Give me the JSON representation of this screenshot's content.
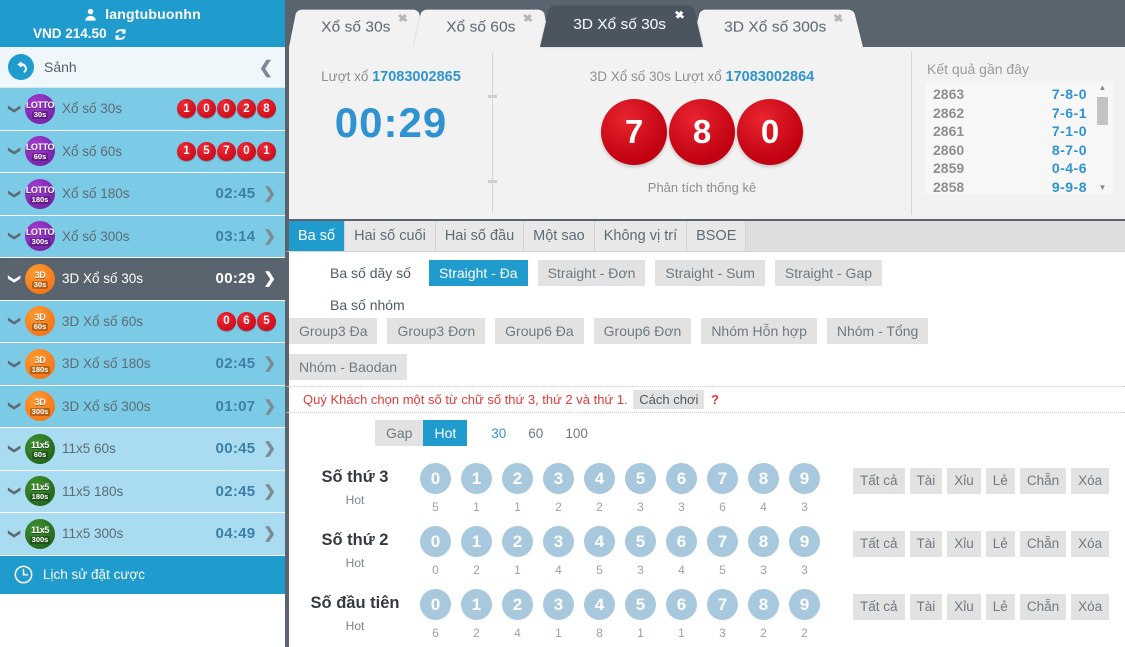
{
  "account": {
    "username": "langtubuonhn",
    "currency_label": "VND",
    "balance": "214.50",
    "user_icon": "user-icon",
    "refresh_icon": "refresh-icon"
  },
  "lobby": {
    "label": "Sảnh",
    "back_icon": "back-arrow-icon",
    "collapse_icon": "chevron-left-icon"
  },
  "sidebar": {
    "games": [
      {
        "name": "Xổ số 30s",
        "badge": "lotto",
        "badge_top": "LOTTO",
        "badge_bot": "30s",
        "type": "balls",
        "balls": [
          "1",
          "0",
          "0",
          "2",
          "8"
        ],
        "timer": "",
        "style": "alt"
      },
      {
        "name": "Xổ số 60s",
        "badge": "lotto",
        "badge_top": "LOTTO",
        "badge_bot": "60s",
        "type": "balls",
        "balls": [
          "1",
          "5",
          "7",
          "0",
          "1"
        ],
        "timer": "",
        "style": "alt"
      },
      {
        "name": "Xổ số 180s",
        "badge": "lotto",
        "badge_top": "LOTTO",
        "badge_bot": "180s",
        "type": "timer",
        "balls": [],
        "timer": "02:45",
        "style": "alt"
      },
      {
        "name": "Xổ số 300s",
        "badge": "lotto",
        "badge_top": "LOTTO",
        "badge_bot": "300s",
        "type": "timer",
        "balls": [],
        "timer": "03:14",
        "style": "alt"
      },
      {
        "name": "3D Xổ số 30s",
        "badge": "threed",
        "badge_top": "3D",
        "badge_bot": "30s",
        "type": "timer",
        "balls": [],
        "timer": "00:29",
        "style": "active"
      },
      {
        "name": "3D Xổ số 60s",
        "badge": "threed",
        "badge_top": "3D",
        "badge_bot": "60s",
        "type": "balls",
        "balls": [
          "0",
          "6",
          "5"
        ],
        "timer": "",
        "style": "alt"
      },
      {
        "name": "3D Xổ số 180s",
        "badge": "threed",
        "badge_top": "3D",
        "badge_bot": "180s",
        "type": "timer",
        "balls": [],
        "timer": "02:45",
        "style": "alt"
      },
      {
        "name": "3D Xổ số 300s",
        "badge": "threed",
        "badge_top": "3D",
        "badge_bot": "300s",
        "type": "timer",
        "balls": [],
        "timer": "01:07",
        "style": "alt"
      },
      {
        "name": "11x5 60s",
        "badge": "elevenx",
        "badge_top": "11x5",
        "badge_bot": "60s",
        "type": "timer",
        "balls": [],
        "timer": "00:45",
        "style": "plain"
      },
      {
        "name": "11x5 180s",
        "badge": "elevenx",
        "badge_top": "11x5",
        "badge_bot": "180s",
        "type": "timer",
        "balls": [],
        "timer": "02:45",
        "style": "plain"
      },
      {
        "name": "11x5 300s",
        "badge": "elevenx",
        "badge_top": "11x5",
        "badge_bot": "300s",
        "type": "timer",
        "balls": [],
        "timer": "04:49",
        "style": "plain"
      }
    ],
    "history": {
      "label": "Lịch sử đặt cược",
      "icon": "clock-icon"
    }
  },
  "tabs": [
    {
      "label": "Xổ số 30s",
      "active": false
    },
    {
      "label": "Xổ số 60s",
      "active": false
    },
    {
      "label": "3D Xổ số 30s",
      "active": true
    },
    {
      "label": "3D Xổ số 300s",
      "active": false
    }
  ],
  "board": {
    "left_prefix": "Lượt xổ",
    "left_draw_id": "17083002865",
    "countdown": "00:29",
    "mid_prefix": "3D Xổ số 30s Lượt xổ",
    "mid_draw_id": "17083002864",
    "draw_numbers": [
      "7",
      "8",
      "0"
    ],
    "analysis_label": "Phân tích thống kê",
    "recent_title": "Kết quả gần đây",
    "recent": [
      {
        "id": "2863",
        "value": "7-8-0"
      },
      {
        "id": "2862",
        "value": "7-6-1"
      },
      {
        "id": "2861",
        "value": "7-1-0"
      },
      {
        "id": "2860",
        "value": "8-7-0"
      },
      {
        "id": "2859",
        "value": "0-4-6"
      },
      {
        "id": "2858",
        "value": "9-9-8"
      }
    ]
  },
  "bet_tabs": [
    {
      "label": "Ba số",
      "active": true
    },
    {
      "label": "Hai số cuối",
      "active": false
    },
    {
      "label": "Hai số đầu",
      "active": false
    },
    {
      "label": "Một sao",
      "active": false
    },
    {
      "label": "Không vị trí",
      "active": false
    },
    {
      "label": "BSOE",
      "active": false
    }
  ],
  "option_groups": [
    {
      "label": "Ba số dãy số",
      "options": [
        {
          "label": "Straight - Đa",
          "active": true
        },
        {
          "label": "Straight - Đơn",
          "active": false
        },
        {
          "label": "Straight - Sum",
          "active": false
        },
        {
          "label": "Straight - Gap",
          "active": false
        }
      ]
    },
    {
      "label": "Ba số nhóm",
      "options": [
        {
          "label": "Group3 Đa",
          "active": false
        },
        {
          "label": "Group3 Đơn",
          "active": false
        },
        {
          "label": "Group6 Đa",
          "active": false
        },
        {
          "label": "Group6 Đơn",
          "active": false
        },
        {
          "label": "Nhóm Hỗn hợp",
          "active": false
        },
        {
          "label": "Nhóm - Tổng",
          "active": false
        },
        {
          "label": "Nhóm - Baodan",
          "active": false
        }
      ]
    }
  ],
  "notice": {
    "text": "Quý Khách chọn một số từ chữ số thứ 3, thứ 2 và thứ 1.",
    "howto": "Cách chơi",
    "question": "?"
  },
  "gap_hot": {
    "gap_label": "Gap",
    "hot_label": "Hot",
    "gap_active": false,
    "hot_active": true,
    "counts": [
      {
        "label": "30",
        "active": true
      },
      {
        "label": "60",
        "active": false
      },
      {
        "label": "100",
        "active": false
      }
    ]
  },
  "number_rows": [
    {
      "title": "Số thứ 3",
      "subtitle": "Hot",
      "digits": [
        "0",
        "1",
        "2",
        "3",
        "4",
        "5",
        "6",
        "7",
        "8",
        "9"
      ],
      "counts": [
        "5",
        "1",
        "1",
        "2",
        "2",
        "3",
        "3",
        "6",
        "4",
        "3"
      ]
    },
    {
      "title": "Số thứ 2",
      "subtitle": "Hot",
      "digits": [
        "0",
        "1",
        "2",
        "3",
        "4",
        "5",
        "6",
        "7",
        "8",
        "9"
      ],
      "counts": [
        "0",
        "2",
        "1",
        "4",
        "5",
        "3",
        "4",
        "5",
        "3",
        "3"
      ]
    },
    {
      "title": "Số đầu tiên",
      "subtitle": "Hot",
      "digits": [
        "0",
        "1",
        "2",
        "3",
        "4",
        "5",
        "6",
        "7",
        "8",
        "9"
      ],
      "counts": [
        "6",
        "2",
        "4",
        "1",
        "8",
        "1",
        "1",
        "3",
        "2",
        "2"
      ]
    }
  ],
  "row_actions": [
    "Tất cả",
    "Tài",
    "Xỉu",
    "Lẻ",
    "Chẵn",
    "Xóa"
  ],
  "colors": {
    "accent_blue": "#1f9bcd",
    "dark_slate": "#5a646e",
    "ball_red": "#c20011",
    "light_blue_row": "#a9dcf0",
    "notice_red": "#e23b34"
  }
}
